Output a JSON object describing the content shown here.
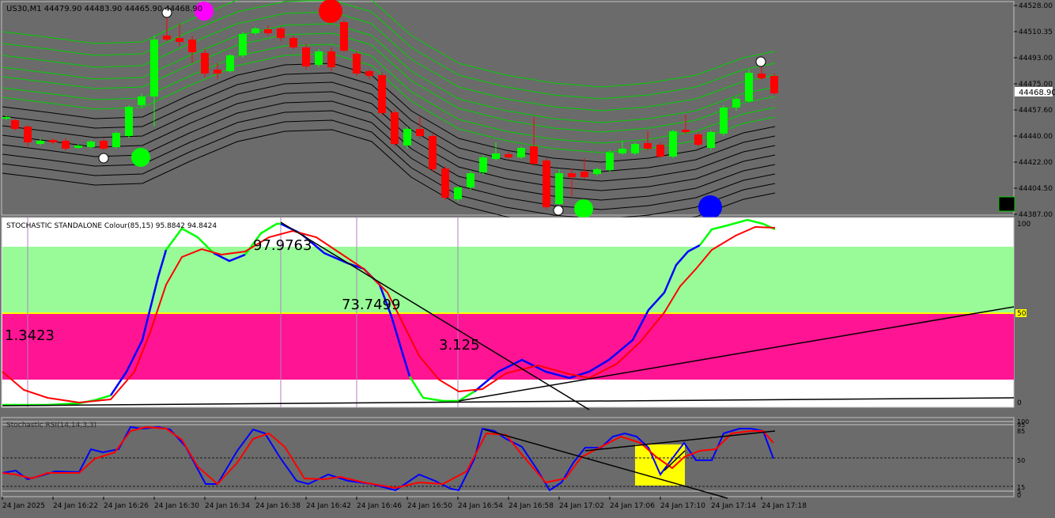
{
  "main": {
    "header": "US30,M1  44479.90 44483.90 44465.90 44468.90",
    "price_scale": [
      "44528.00",
      "44510.35",
      "44493.00",
      "44475.00",
      "44457.60",
      "44440.00",
      "44422.00",
      "44404.50",
      "44387.00"
    ],
    "current_price": "44468.90",
    "colors": {
      "bull": "#00ff00",
      "bear": "#ff0000",
      "bg": "#6b6b6b",
      "band_outer": "#00c800",
      "band_inner": "#000000"
    }
  },
  "stoch": {
    "title": "STOCHASTIC STANDALONE Colour(85,15) 95.8842 94.8424",
    "scale": [
      "100",
      "50",
      "0"
    ],
    "labels": [
      "1.3423",
      "97.9763",
      "73.7499",
      "3.125"
    ],
    "colors": {
      "zone_green": "#98fb98",
      "zone_pink": "#ff1493",
      "k_up": "#00ff00",
      "k_down": "#0000ff",
      "d": "#ff0000"
    }
  },
  "lower": {
    "title": "Stochastic RSI(14,14,3,3)",
    "scale": [
      "100",
      "95",
      "85",
      "50",
      "15",
      "5",
      "0"
    ],
    "colors": {
      "k": "#0000ff",
      "d": "#ff0000",
      "highlight": "#ffff00"
    }
  },
  "time_axis": [
    "24 Jan 2025",
    "24 Jan 16:22",
    "24 Jan 16:26",
    "24 Jan 16:30",
    "24 Jan 16:34",
    "24 Jan 16:38",
    "24 Jan 16:42",
    "24 Jan 16:46",
    "24 Jan 16:50",
    "24 Jan 16:54",
    "24 Jan 16:58",
    "24 Jan 17:02",
    "24 Jan 17:06",
    "24 Jan 17:10",
    "24 Jan 17:14",
    "24 Jan 17:18"
  ]
}
